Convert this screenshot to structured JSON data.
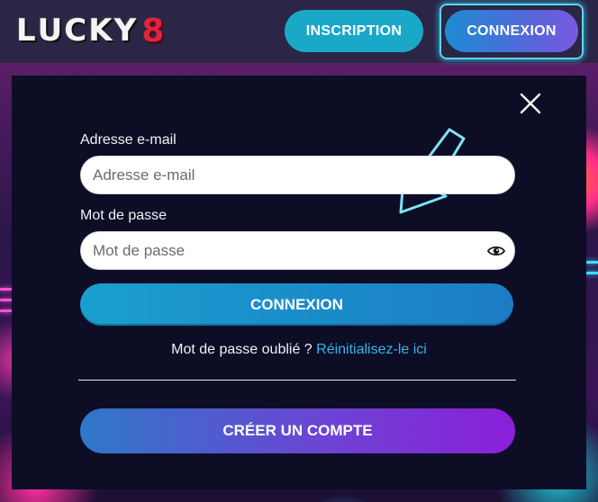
{
  "header": {
    "logo_letters": [
      "L",
      "U",
      "C",
      "K",
      "Y"
    ],
    "logo_number": "8",
    "inscription_label": "INSCRIPTION",
    "connexion_label": "CONNEXION"
  },
  "login_modal": {
    "email_label": "Adresse e-mail",
    "email_placeholder": "Adresse e-mail",
    "email_value": "",
    "password_label": "Mot de passe",
    "password_placeholder": "Mot de passe",
    "password_value": "",
    "login_button": "CONNEXION",
    "forgot_text": "Mot de passe oublié ?",
    "reset_link": "Réinitialisez-le ici",
    "create_account_button": "CRÉER UN COMPTE"
  },
  "icons": {
    "close": "close-icon",
    "password_toggle": "eye-icon",
    "hint_arrow": "arrow-icon"
  },
  "colors": {
    "header_bg": "#2b2546",
    "modal_bg": "#0d0d26",
    "accent_cyan": "#1aa8c9",
    "link_blue": "#35b6e9",
    "logo_red": "#e0233f",
    "create_gradient_end": "#8b1fd8"
  }
}
